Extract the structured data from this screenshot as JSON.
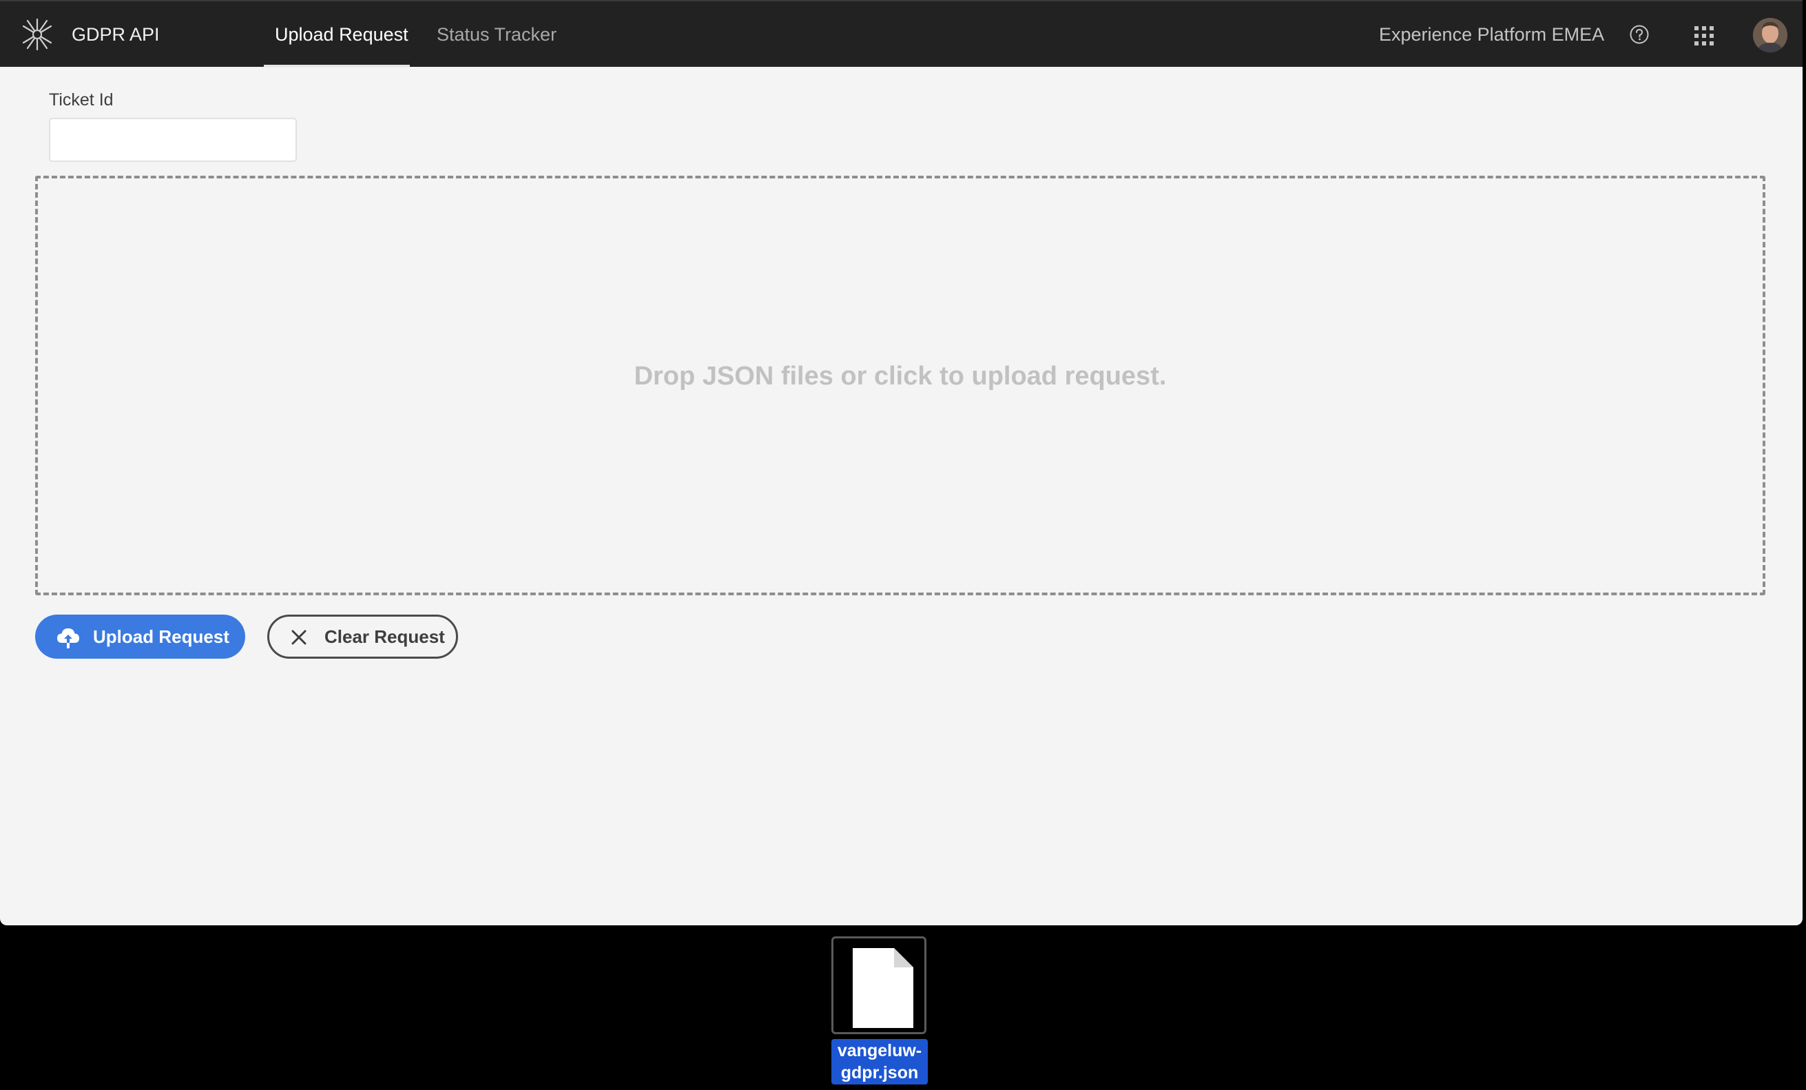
{
  "header": {
    "app_title": "GDPR API",
    "logo_icon": "adobe-experience-platform-logo",
    "tabs": [
      {
        "label": "Upload Request",
        "active": true
      },
      {
        "label": "Status Tracker",
        "active": false
      }
    ],
    "region": "Experience Platform EMEA",
    "help_icon": "help-circle-icon",
    "apps_icon": "app-grid-icon",
    "avatar_icon": "user-avatar"
  },
  "form": {
    "ticket_label": "Ticket Id",
    "ticket_value": "",
    "dropzone_text": "Drop JSON files or click to upload request."
  },
  "actions": {
    "upload_label": "Upload Request",
    "upload_icon": "cloud-upload-icon",
    "clear_label": "Clear Request",
    "clear_icon": "close-icon"
  },
  "dragged_file": {
    "name_line1": "vangeluw-",
    "name_line2": "gdpr.json",
    "icon": "document-file-icon"
  },
  "colors": {
    "topbar_bg": "#222222",
    "page_bg": "#f4f4f4",
    "primary_button": "#3b7ae0",
    "selection_blue": "#1d56d3"
  }
}
